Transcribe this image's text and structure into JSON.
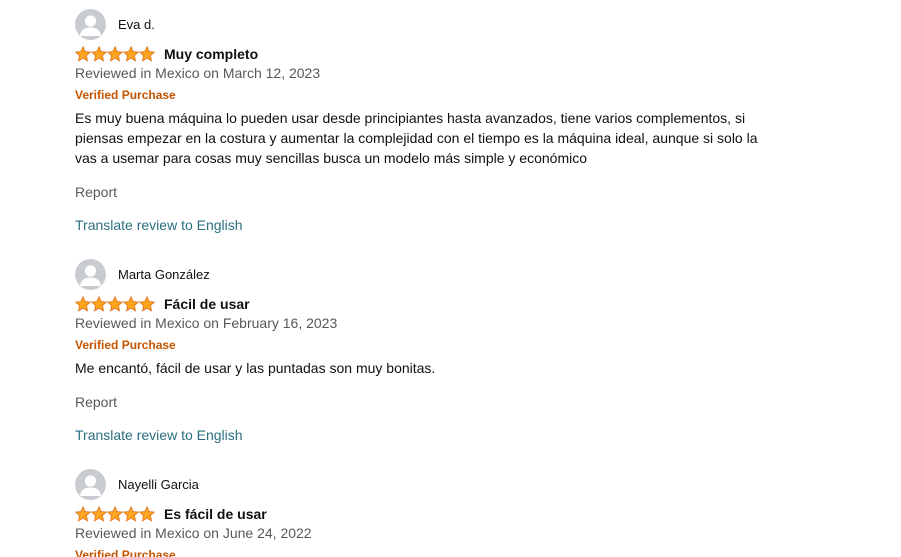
{
  "colors": {
    "star": "#ffa41c",
    "verified": "#c45500",
    "link": "#2a6f7f",
    "muted": "#565959",
    "text": "#0f1111",
    "avatar_bg": "#c8ccd1"
  },
  "reviews": [
    {
      "profile_name": "Eva d.",
      "rating": 5,
      "title": "Muy completo",
      "date": "Reviewed in Mexico on March 12, 2023",
      "verified": "Verified Purchase",
      "body": "Es muy buena máquina lo pueden usar desde principiantes hasta avanzados, tiene varios complementos, si piensas empezar en la costura y aumentar la complejidad con el tiempo es la máquina ideal, aunque si solo la vas a usemar para cosas muy sencillas busca un modelo más simple y económico",
      "report": "Report",
      "translate": "Translate review to English"
    },
    {
      "profile_name": "Marta González",
      "rating": 5,
      "title": "Fácil de usar",
      "date": "Reviewed in Mexico on February 16, 2023",
      "verified": "Verified Purchase",
      "body": "Me encantó, fácil de usar y las puntadas son muy bonitas.",
      "report": "Report",
      "translate": "Translate review to English"
    },
    {
      "profile_name": "Nayelli Garcia",
      "rating": 5,
      "title": "Es fácil de usar",
      "date": "Reviewed in Mexico on June 24, 2022",
      "verified": "Verified Purchase"
    }
  ]
}
